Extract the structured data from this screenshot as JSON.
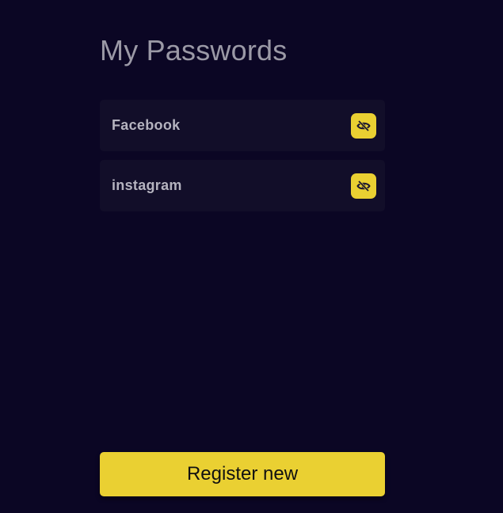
{
  "page": {
    "title": "My Passwords"
  },
  "passwords": [
    {
      "label": "Facebook",
      "toggle_icon": "eye-slash-icon"
    },
    {
      "label": "instagram",
      "toggle_icon": "eye-slash-icon"
    }
  ],
  "footer": {
    "register_label": "Register new"
  },
  "colors": {
    "background": "#0b0624",
    "card": "#120e29",
    "accent": "#ead032",
    "title_text": "#9b99a6",
    "card_text": "#b5b3bf"
  }
}
